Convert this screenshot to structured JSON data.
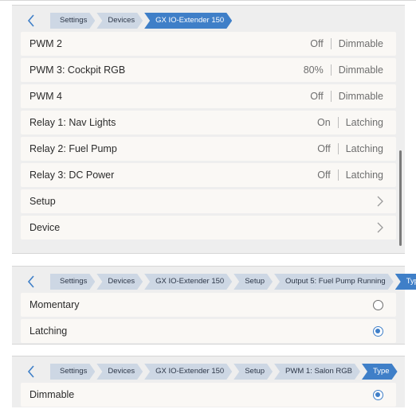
{
  "panel1": {
    "breadcrumbs": [
      "Settings",
      "Devices",
      "GX IO-Extender 150"
    ],
    "rows": [
      {
        "label": "PWM 2",
        "value": "Off",
        "mode": "Dimmable"
      },
      {
        "label": "PWM 3: Cockpit RGB",
        "value": "80%",
        "mode": "Dimmable"
      },
      {
        "label": "PWM 4",
        "value": "Off",
        "mode": "Dimmable"
      },
      {
        "label": "Relay 1: Nav Lights",
        "value": "On",
        "mode": "Latching"
      },
      {
        "label": "Relay 2: Fuel Pump",
        "value": "Off",
        "mode": "Latching"
      },
      {
        "label": "Relay 3: DC Power",
        "value": "Off",
        "mode": "Latching"
      }
    ],
    "setup_label": "Setup",
    "device_label": "Device"
  },
  "panel2": {
    "breadcrumbs": [
      "Settings",
      "Devices",
      "GX IO-Extender 150",
      "Setup",
      "Output 5: Fuel Pump Running",
      "Type"
    ],
    "options": [
      {
        "label": "Momentary",
        "selected": false
      },
      {
        "label": "Latching",
        "selected": true
      }
    ]
  },
  "panel3": {
    "breadcrumbs": [
      "Settings",
      "Devices",
      "GX IO-Extender 150",
      "Setup",
      "PWM 1: Salon RGB",
      "Type"
    ],
    "options": [
      {
        "label": "Dimmable",
        "selected": true
      }
    ]
  },
  "icons": {
    "back": "chevron-left-icon",
    "forward": "chevron-right-icon",
    "radio": "radio-button-icon"
  },
  "colors": {
    "accent": "#3f7fc8",
    "crumb": "#cdd7e4",
    "row": "#faf8f5",
    "panel": "#eeeeee"
  }
}
